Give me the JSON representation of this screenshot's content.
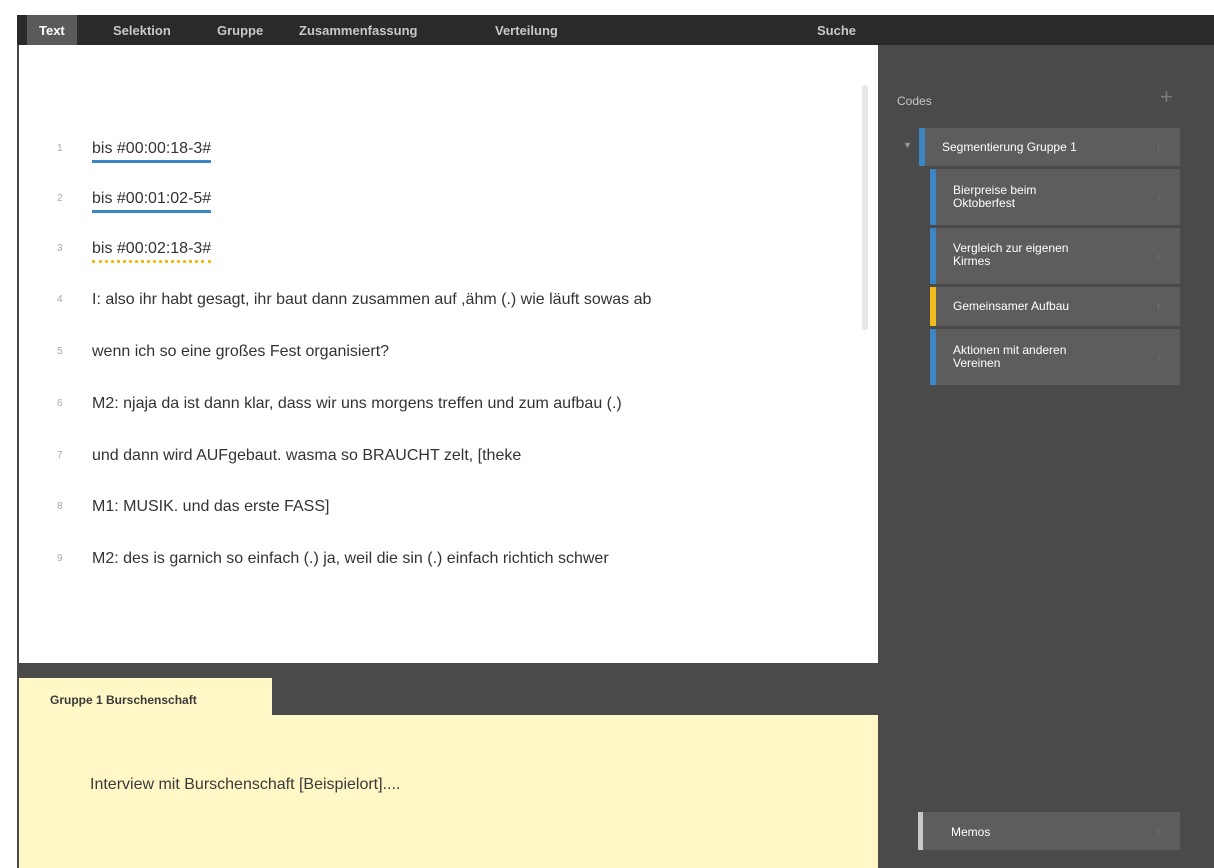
{
  "nav": {
    "tabs": [
      {
        "label": "Text"
      },
      {
        "label": "Selektion"
      },
      {
        "label": "Gruppe"
      },
      {
        "label": "Zusammenfassung"
      },
      {
        "label": "Verteilung"
      }
    ],
    "search_label": "Suche"
  },
  "transcript": {
    "lines": [
      {
        "num": "1",
        "text": "bis #00:00:18-3#"
      },
      {
        "num": "2",
        "text": "bis #00:01:02-5#"
      },
      {
        "num": "3",
        "text": "bis #00:02:18-3#"
      },
      {
        "num": "4",
        "text": "I: also ihr habt gesagt, ihr baut dann zusammen auf ,ähm (.) wie läuft sowas ab"
      },
      {
        "num": "5",
        "text": "wenn ich so eine großes Fest organisiert?"
      },
      {
        "num": "6",
        "text": "M2: njaja da ist dann klar, dass wir uns morgens treffen und zum aufbau (.)"
      },
      {
        "num": "7",
        "text": "und dann wird AUFgebaut. wasma so BRAUCHT zelt, [theke"
      },
      {
        "num": "8",
        "text": "M1: MUSIK. und das erste FASS]"
      },
      {
        "num": "9",
        "text": "M2: des is garnich so einfach (.) ja, weil die sin (.) einfach richtich schwer"
      }
    ]
  },
  "memo": {
    "tab_label": "Gruppe 1 Burschenschaft",
    "text": "Interview mit Burschenschaft [Beispielort]...."
  },
  "codes": {
    "title": "Codes",
    "add_icon": "plus-icon",
    "group": {
      "label": "Segmentierung Gruppe 1",
      "color": "#3d86c4"
    },
    "items": [
      {
        "label_1": "Bierpreise beim",
        "label_2": "Oktoberfest",
        "color": "#3d86c4"
      },
      {
        "label_1": "Vergleich zur eigenen",
        "label_2": "Kirmes",
        "color": "#3d86c4"
      },
      {
        "label_1": "Gemeinsamer Aufbau",
        "label_2": "",
        "color": "#f2bc1a"
      },
      {
        "label_1": "Aktionen mit anderen",
        "label_2": "Vereinen",
        "color": "#3d86c4"
      }
    ],
    "memos_label": "Memos"
  },
  "colors": {
    "code_blue": "#3d86c4",
    "code_yellow": "#f2bc1a",
    "memo_background": "#fff8c6",
    "app_background": "#4a4a4a",
    "nav_background": "#2a2a2a"
  }
}
